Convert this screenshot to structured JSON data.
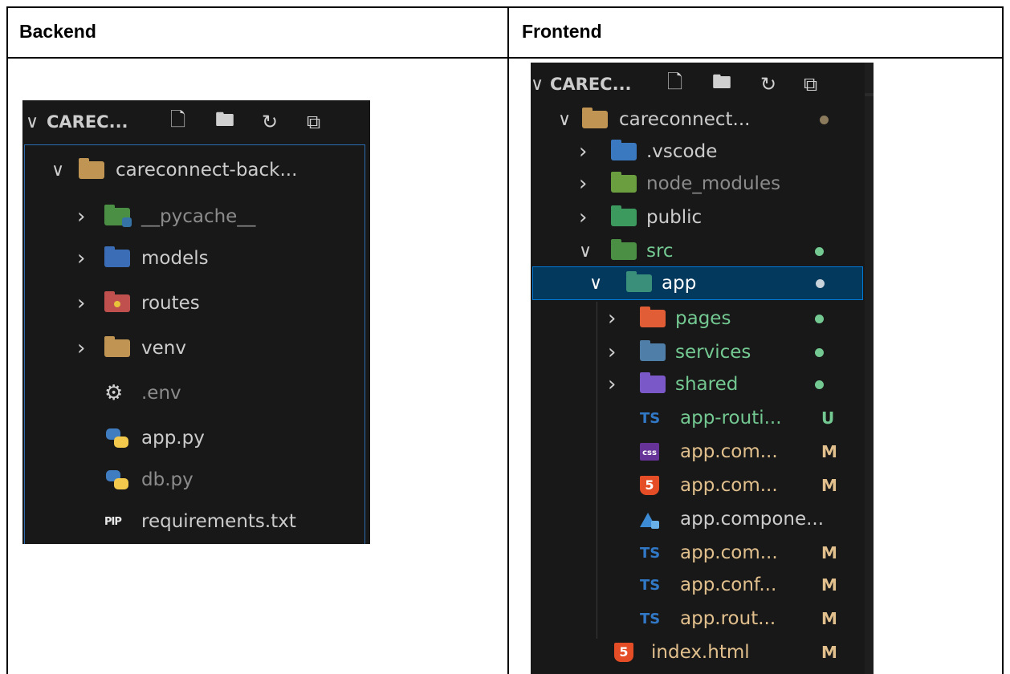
{
  "headers": {
    "backend": "Backend",
    "frontend": "Frontend"
  },
  "backend": {
    "explorer_title": "CAREC...",
    "root": "careconnect-back...",
    "items": [
      {
        "label": "__pycache__",
        "kind": "folder",
        "icon": "python-folder-icon"
      },
      {
        "label": "models",
        "kind": "folder",
        "icon": "models-folder-icon"
      },
      {
        "label": "routes",
        "kind": "folder",
        "icon": "routes-folder-icon"
      },
      {
        "label": "venv",
        "kind": "folder",
        "icon": "folder-icon"
      },
      {
        "label": ".env",
        "kind": "file",
        "icon": "gear-icon"
      },
      {
        "label": "app.py",
        "kind": "file",
        "icon": "python-icon"
      },
      {
        "label": "db.py",
        "kind": "file",
        "icon": "python-icon"
      },
      {
        "label": "requirements.txt",
        "kind": "file",
        "icon": "pip-icon",
        "icon_text": "PIP"
      }
    ]
  },
  "frontend": {
    "explorer_title": "CAREC...",
    "root": "careconnect...",
    "items": [
      {
        "label": ".vscode",
        "icon": "vscode-folder-icon"
      },
      {
        "label": "node_modules",
        "icon": "node-folder-icon"
      },
      {
        "label": "public",
        "icon": "public-folder-icon"
      },
      {
        "label": "src",
        "icon": "src-folder-icon"
      },
      {
        "label": "app",
        "icon": "app-folder-icon"
      },
      {
        "label": "pages",
        "icon": "pages-folder-icon"
      },
      {
        "label": "services",
        "icon": "services-folder-icon"
      },
      {
        "label": "shared",
        "icon": "shared-folder-icon"
      },
      {
        "label": "app-routi...",
        "icon": "typescript-icon",
        "icon_text": "TS",
        "status": "U"
      },
      {
        "label": "app.com...",
        "icon": "css-icon",
        "icon_text": "css",
        "status": "M"
      },
      {
        "label": "app.com...",
        "icon": "html5-icon",
        "icon_text": "5",
        "status": "M"
      },
      {
        "label": "app.compone...",
        "icon": "angular-icon"
      },
      {
        "label": "app.com...",
        "icon": "typescript-icon",
        "icon_text": "TS",
        "status": "M"
      },
      {
        "label": "app.conf...",
        "icon": "typescript-icon",
        "icon_text": "TS",
        "status": "M"
      },
      {
        "label": "app.rout...",
        "icon": "typescript-icon",
        "icon_text": "TS",
        "status": "M"
      },
      {
        "label": "index.html",
        "icon": "html5-icon",
        "icon_text": "5",
        "status": "M"
      }
    ]
  },
  "colors": {
    "panel_bg": "#181818",
    "selection_bg": "#04395e",
    "selection_border": "#0078d4",
    "git_modified": "#e2c08d",
    "git_untracked": "#73c991",
    "typescript": "#3178c6",
    "html5": "#e44d26",
    "css": "#663399"
  }
}
